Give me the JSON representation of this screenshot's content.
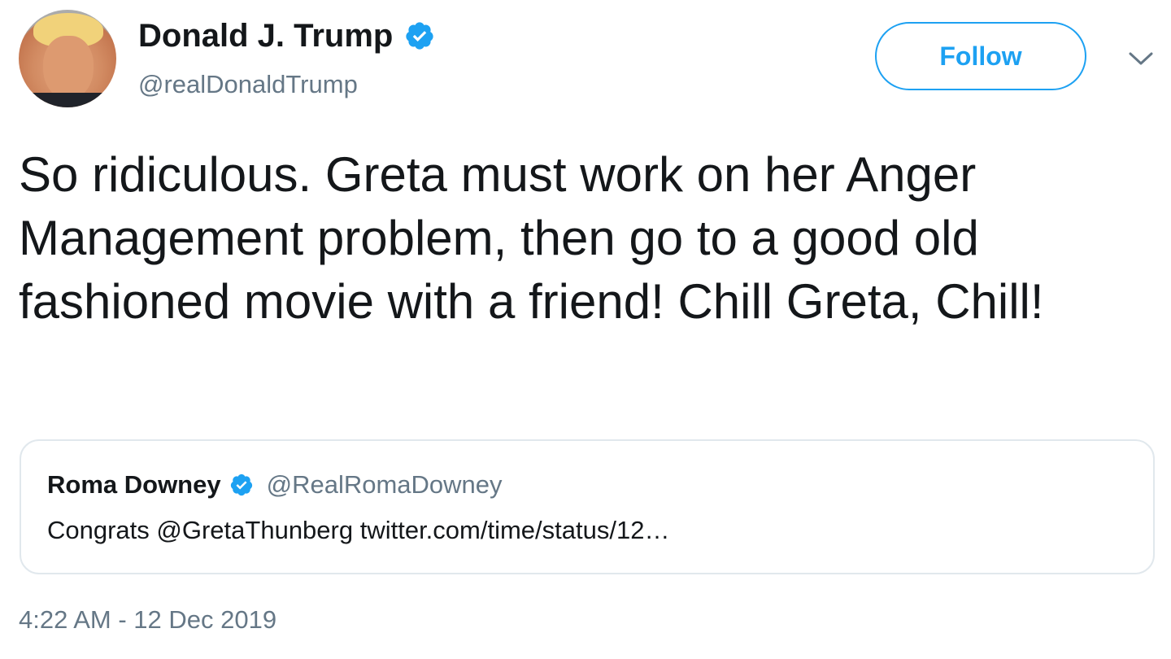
{
  "author": {
    "display_name": "Donald J. Trump",
    "handle": "@realDonaldTrump",
    "verified_icon": "verified-badge-icon"
  },
  "actions": {
    "follow_label": "Follow",
    "menu_icon": "chevron-down-icon"
  },
  "tweet": {
    "text": "So ridiculous. Greta must work on her Anger Management problem, then go to a good old fashioned movie with a friend! Chill Greta, Chill!",
    "timestamp": "4:22 AM - 12 Dec 2019"
  },
  "quoted_tweet": {
    "display_name": "Roma Downey",
    "handle": "@RealRomaDowney",
    "text": "Congrats @GretaThunberg twitter.com/time/status/12…"
  },
  "colors": {
    "accent": "#1da1f2",
    "text_primary": "#14171a",
    "text_secondary": "#657786",
    "border": "#e1e8ed"
  }
}
